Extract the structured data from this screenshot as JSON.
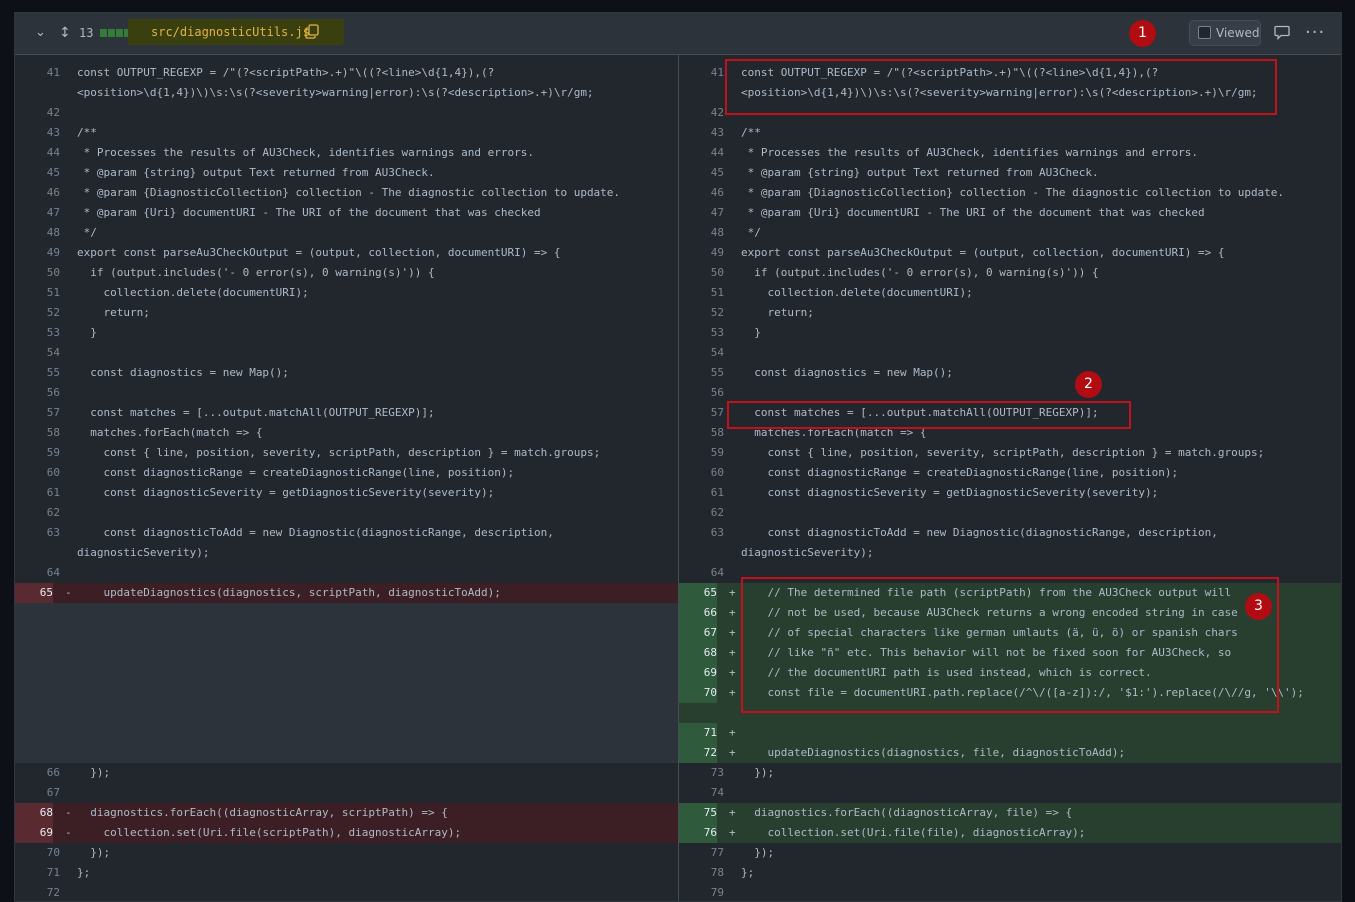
{
  "header": {
    "count": "13",
    "file_path": "src/diagnosticUtils.js",
    "viewed_label": "Viewed",
    "diffstat_colors": [
      "#347d39",
      "#347d39",
      "#347d39",
      "#347d39",
      "#c93c37",
      "#768390"
    ]
  },
  "badges": [
    "1",
    "2",
    "3"
  ],
  "left": [
    {
      "ln": "41",
      "type": "ctx",
      "code": "const OUTPUT_REGEXP = /\"(?<scriptPath>.+)\"\\((?<line>\\d{1,4}),(?<position>\\d{1,4})\\)\\s:\\s(?<severity>warning|error):\\s(?<description>.+)\\r/gm;"
    },
    {
      "ln": "42",
      "type": "ctx",
      "code": ""
    },
    {
      "ln": "43",
      "type": "ctx",
      "code": "/**"
    },
    {
      "ln": "44",
      "type": "ctx",
      "code": " * Processes the results of AU3Check, identifies warnings and errors."
    },
    {
      "ln": "45",
      "type": "ctx",
      "code": " * @param {string} output Text returned from AU3Check."
    },
    {
      "ln": "46",
      "type": "ctx",
      "code": " * @param {DiagnosticCollection} collection - The diagnostic collection to update."
    },
    {
      "ln": "47",
      "type": "ctx",
      "code": " * @param {Uri} documentURI - The URI of the document that was checked"
    },
    {
      "ln": "48",
      "type": "ctx",
      "code": " */"
    },
    {
      "ln": "49",
      "type": "ctx",
      "code": "export const parseAu3CheckOutput = (output, collection, documentURI) => {"
    },
    {
      "ln": "50",
      "type": "ctx",
      "code": "  if (output.includes('- 0 error(s), 0 warning(s)')) {"
    },
    {
      "ln": "51",
      "type": "ctx",
      "code": "    collection.delete(documentURI);"
    },
    {
      "ln": "52",
      "type": "ctx",
      "code": "    return;"
    },
    {
      "ln": "53",
      "type": "ctx",
      "code": "  }"
    },
    {
      "ln": "54",
      "type": "ctx",
      "code": ""
    },
    {
      "ln": "55",
      "type": "ctx",
      "code": "  const diagnostics = new Map();"
    },
    {
      "ln": "56",
      "type": "ctx",
      "code": ""
    },
    {
      "ln": "57",
      "type": "ctx",
      "code": "  const matches = [...output.matchAll(OUTPUT_REGEXP)];"
    },
    {
      "ln": "58",
      "type": "ctx",
      "code": "  matches.forEach(match => {"
    },
    {
      "ln": "59",
      "type": "ctx",
      "code": "    const { line, position, severity, scriptPath, description } = match.groups;"
    },
    {
      "ln": "60",
      "type": "ctx",
      "code": "    const diagnosticRange = createDiagnosticRange(line, position);"
    },
    {
      "ln": "61",
      "type": "ctx",
      "code": "    const diagnosticSeverity = getDiagnosticSeverity(severity);"
    },
    {
      "ln": "62",
      "type": "ctx",
      "code": ""
    },
    {
      "ln": "63",
      "type": "ctx",
      "code": "    const diagnosticToAdd = new Diagnostic(diagnosticRange, description, diagnosticSeverity);"
    },
    {
      "ln": "64",
      "type": "ctx",
      "code": ""
    },
    {
      "ln": "65",
      "type": "del",
      "code": "    updateDiagnostics(diagnostics, scriptPath, diagnosticToAdd);"
    },
    {
      "ln": "66",
      "type": "ctx",
      "code": "  });"
    },
    {
      "ln": "67",
      "type": "ctx",
      "code": ""
    },
    {
      "ln": "68",
      "type": "del",
      "code": "  diagnostics.forEach((diagnosticArray, scriptPath) => {"
    },
    {
      "ln": "69",
      "type": "del",
      "code": "    collection.set(Uri.file(scriptPath), diagnosticArray);"
    },
    {
      "ln": "70",
      "type": "ctx",
      "code": "  });"
    },
    {
      "ln": "71",
      "type": "ctx",
      "code": "};"
    },
    {
      "ln": "72",
      "type": "ctx",
      "code": ""
    }
  ],
  "right": [
    {
      "ln": "41",
      "type": "ctx",
      "code": "const OUTPUT_REGEXP = /\"(?<scriptPath>.+)\"\\((?<line>\\d{1,4}),(?<position>\\d{1,4})\\)\\s:\\s(?<severity>warning|error):\\s(?<description>.+)\\r/gm;"
    },
    {
      "ln": "42",
      "type": "ctx",
      "code": ""
    },
    {
      "ln": "43",
      "type": "ctx",
      "code": "/**"
    },
    {
      "ln": "44",
      "type": "ctx",
      "code": " * Processes the results of AU3Check, identifies warnings and errors."
    },
    {
      "ln": "45",
      "type": "ctx",
      "code": " * @param {string} output Text returned from AU3Check."
    },
    {
      "ln": "46",
      "type": "ctx",
      "code": " * @param {DiagnosticCollection} collection - The diagnostic collection to update."
    },
    {
      "ln": "47",
      "type": "ctx",
      "code": " * @param {Uri} documentURI - The URI of the document that was checked"
    },
    {
      "ln": "48",
      "type": "ctx",
      "code": " */"
    },
    {
      "ln": "49",
      "type": "ctx",
      "code": "export const parseAu3CheckOutput = (output, collection, documentURI) => {"
    },
    {
      "ln": "50",
      "type": "ctx",
      "code": "  if (output.includes('- 0 error(s), 0 warning(s)')) {"
    },
    {
      "ln": "51",
      "type": "ctx",
      "code": "    collection.delete(documentURI);"
    },
    {
      "ln": "52",
      "type": "ctx",
      "code": "    return;"
    },
    {
      "ln": "53",
      "type": "ctx",
      "code": "  }"
    },
    {
      "ln": "54",
      "type": "ctx",
      "code": ""
    },
    {
      "ln": "55",
      "type": "ctx",
      "code": "  const diagnostics = new Map();"
    },
    {
      "ln": "56",
      "type": "ctx",
      "code": ""
    },
    {
      "ln": "57",
      "type": "ctx",
      "code": "  const matches = [...output.matchAll(OUTPUT_REGEXP)];"
    },
    {
      "ln": "58",
      "type": "ctx",
      "code": "  matches.forEach(match => {"
    },
    {
      "ln": "59",
      "type": "ctx",
      "code": "    const { line, position, severity, scriptPath, description } = match.groups;"
    },
    {
      "ln": "60",
      "type": "ctx",
      "code": "    const diagnosticRange = createDiagnosticRange(line, position);"
    },
    {
      "ln": "61",
      "type": "ctx",
      "code": "    const diagnosticSeverity = getDiagnosticSeverity(severity);"
    },
    {
      "ln": "62",
      "type": "ctx",
      "code": ""
    },
    {
      "ln": "63",
      "type": "ctx",
      "code": "    const diagnosticToAdd = new Diagnostic(diagnosticRange, description, diagnosticSeverity);"
    },
    {
      "ln": "64",
      "type": "ctx",
      "code": ""
    },
    {
      "ln": "65",
      "type": "add",
      "code": "    // The determined file path (scriptPath) from the AU3Check output will"
    },
    {
      "ln": "66",
      "type": "add",
      "code": "    // not be used, because AU3Check returns a wrong encoded string in case"
    },
    {
      "ln": "67",
      "type": "add",
      "code": "    // of special characters like german umlauts (ä, ü, ö) or spanish chars"
    },
    {
      "ln": "68",
      "type": "add",
      "code": "    // like \"ñ\" etc. This behavior will not be fixed soon for AU3Check, so"
    },
    {
      "ln": "69",
      "type": "add",
      "code": "    // the documentURI path is used instead, which is correct."
    },
    {
      "ln": "70",
      "type": "add",
      "code": "    const file = documentURI.path.replace(/^\\/([a-z]):/, '$1:').replace(/\\//g, '\\\\');"
    },
    {
      "ln": "71",
      "type": "add",
      "code": ""
    },
    {
      "ln": "72",
      "type": "add",
      "code": "    updateDiagnostics(diagnostics, file, diagnosticToAdd);"
    },
    {
      "ln": "73",
      "type": "ctx",
      "code": "  });"
    },
    {
      "ln": "74",
      "type": "ctx",
      "code": ""
    },
    {
      "ln": "75",
      "type": "add",
      "code": "  diagnostics.forEach((diagnosticArray, file) => {"
    },
    {
      "ln": "76",
      "type": "add",
      "code": "    collection.set(Uri.file(file), diagnosticArray);"
    },
    {
      "ln": "77",
      "type": "ctx",
      "code": "  });"
    },
    {
      "ln": "78",
      "type": "ctx",
      "code": "};"
    },
    {
      "ln": "79",
      "type": "ctx",
      "code": ""
    }
  ]
}
